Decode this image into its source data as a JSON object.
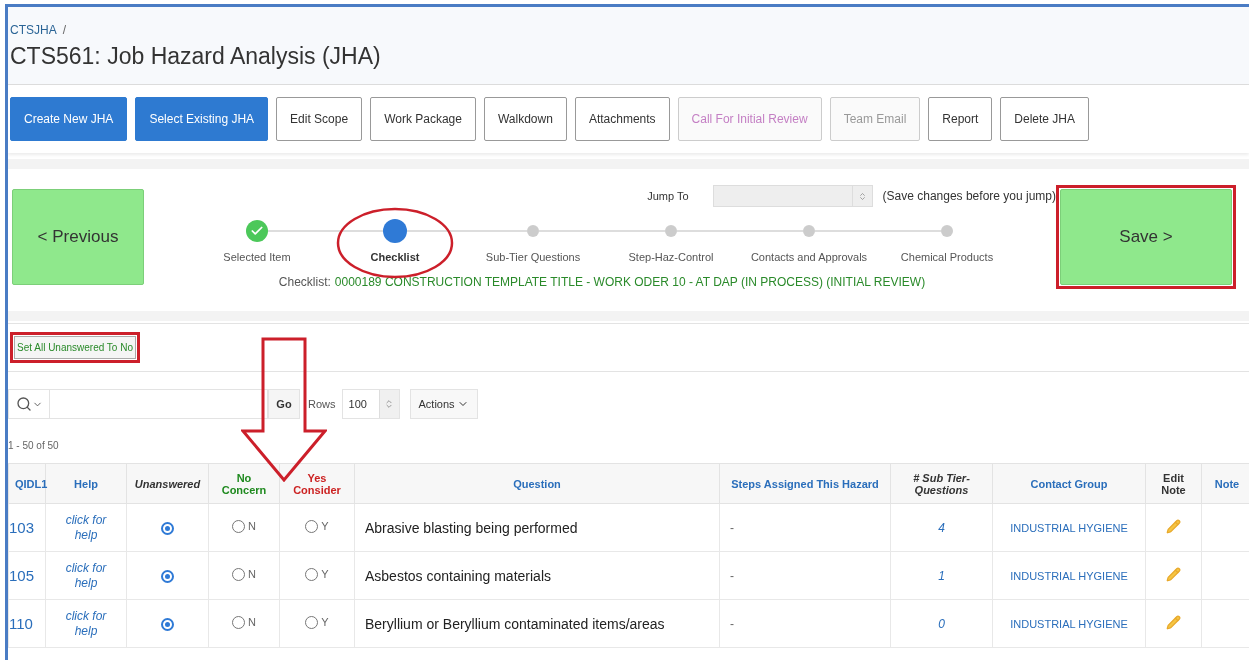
{
  "breadcrumb": "CTSJHA",
  "breadcrumb_separator": "/",
  "title": "CTS561: Job Hazard Analysis (JHA)",
  "toolbar": [
    {
      "label": "Create New JHA",
      "kind": "primary"
    },
    {
      "label": "Select Existing JHA",
      "kind": "primary"
    },
    {
      "label": "Edit Scope",
      "kind": "default"
    },
    {
      "label": "Work Package",
      "kind": "default"
    },
    {
      "label": "Walkdown",
      "kind": "default"
    },
    {
      "label": "Attachments",
      "kind": "default"
    },
    {
      "label": "Call For Initial Review",
      "kind": "accent-disabled"
    },
    {
      "label": "Team Email",
      "kind": "disabled"
    },
    {
      "label": "Report",
      "kind": "default"
    },
    {
      "label": "Delete JHA",
      "kind": "default"
    }
  ],
  "jump": {
    "label": "Jump To",
    "note": "(Save changes before you jump)"
  },
  "previous_button": {
    "label": "< Previous",
    "highlighted": false
  },
  "save_button": {
    "label": "Save >",
    "highlighted": true
  },
  "steps": [
    {
      "label": "Selected Item",
      "kind": "complete",
      "circled": false
    },
    {
      "label": "Checklist",
      "kind": "current",
      "circled": true
    },
    {
      "label": "Sub-Tier Questions",
      "kind": "pending",
      "circled": false
    },
    {
      "label": "Step-Haz-Control",
      "kind": "pending",
      "circled": false
    },
    {
      "label": "Contacts and Approvals",
      "kind": "pending",
      "circled": false
    },
    {
      "label": "Chemical Products",
      "kind": "pending",
      "circled": false
    }
  ],
  "checklist": {
    "label": "Checklist:",
    "value": "0000189 CONSTRUCTION TEMPLATE TITLE - WORK ODER 10 - AT DAP (IN PROCESS) (INITIAL REVIEW)"
  },
  "set_all_button": {
    "label": "Set All Unanswered To No",
    "highlighted": true
  },
  "annotations": [
    {
      "kind": "down-arrow"
    }
  ],
  "report_toolbar": {
    "go": "Go",
    "rows_label": "Rows",
    "rows_value": "100",
    "actions": "Actions"
  },
  "pagination": "1 - 50 of 50",
  "table": {
    "columns": [
      {
        "label": "QIDL1",
        "kind": "link"
      },
      {
        "label": "Help",
        "kind": "link"
      },
      {
        "label": "Unanswered",
        "kind": "italic"
      },
      {
        "label": "No Concern",
        "kind": "positive"
      },
      {
        "label": "Yes Consider",
        "kind": "negative"
      },
      {
        "label": "Question",
        "kind": "link"
      },
      {
        "label": "Steps Assigned This Hazard",
        "kind": "link"
      },
      {
        "label": "# Sub Tier-Questions",
        "kind": "italic"
      },
      {
        "label": "Contact Group",
        "kind": "link"
      },
      {
        "label": "Edit Note",
        "kind": "plain"
      },
      {
        "label": "Note",
        "kind": "link"
      }
    ],
    "rows": [
      {
        "qid": "103",
        "help": "click for help",
        "answers": [
          {
            "selected": true
          },
          {
            "label": "N",
            "selected": false
          },
          {
            "label": "Y",
            "selected": false
          }
        ],
        "question": "Abrasive blasting being performed",
        "steps": "-",
        "sub_tier": "4",
        "contact_group": "INDUSTRIAL HYGIENE"
      },
      {
        "qid": "105",
        "help": "click for help",
        "answers": [
          {
            "selected": true
          },
          {
            "label": "N",
            "selected": false
          },
          {
            "label": "Y",
            "selected": false
          }
        ],
        "question": "Asbestos containing materials",
        "steps": "-",
        "sub_tier": "1",
        "contact_group": "INDUSTRIAL HYGIENE"
      },
      {
        "qid": "110",
        "help": "click for help",
        "answers": [
          {
            "selected": true
          },
          {
            "label": "N",
            "selected": false
          },
          {
            "label": "Y",
            "selected": false
          }
        ],
        "question": "Beryllium or Beryllium contaminated items/areas",
        "steps": "-",
        "sub_tier": "0",
        "contact_group": "INDUSTRIAL HYGIENE"
      }
    ]
  }
}
